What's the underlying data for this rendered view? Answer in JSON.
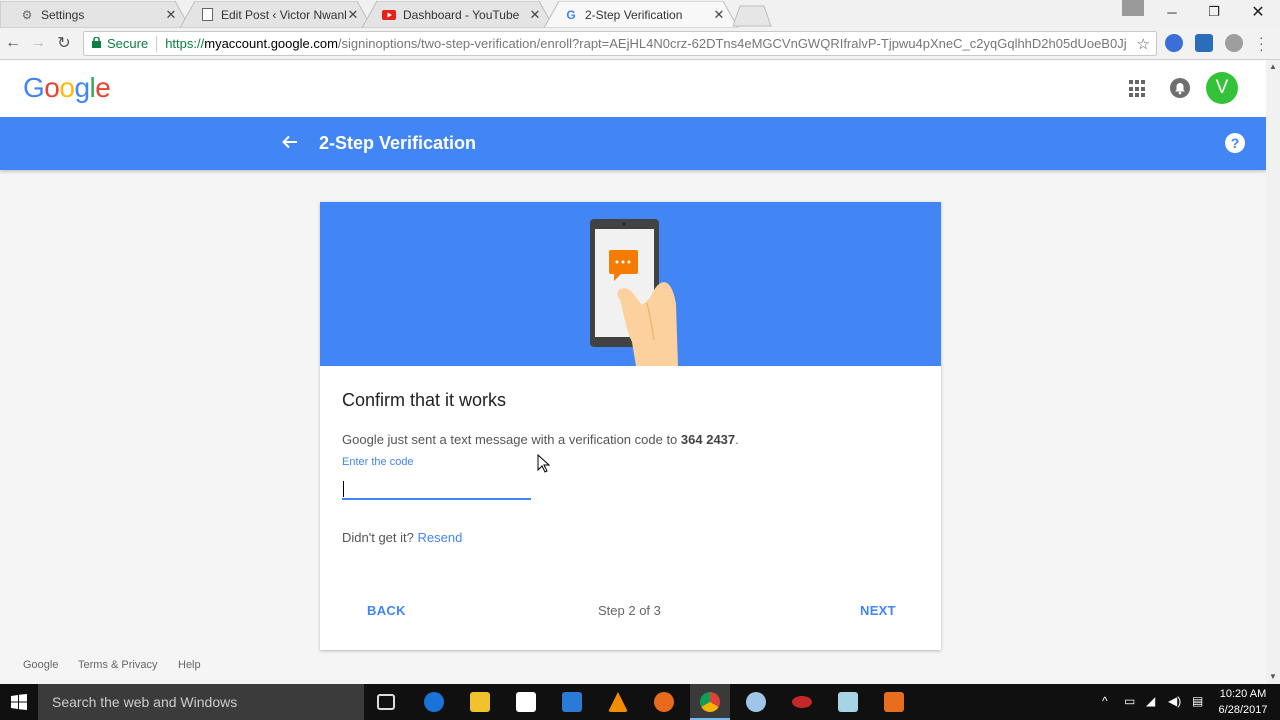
{
  "browser": {
    "tabs": [
      {
        "title": "Settings",
        "icon": "gear-icon"
      },
      {
        "title": "Edit Post ‹ Victor Nwanky",
        "icon": "document-icon"
      },
      {
        "title": "Dashboard - YouTube",
        "icon": "youtube-icon"
      },
      {
        "title": "2-Step Verification",
        "icon": "google-icon"
      }
    ],
    "secure_label": "Secure",
    "url_scheme": "https://",
    "url_host": "myaccount.google.com",
    "url_path": "/signinoptions/two-step-verification/enroll?rapt=AEjHL4N0crz-62DTns4eMGCVnGWQRIfralvP-Tjpwu4pXneC_c2yqGqlhhD2h05dUoeB0Jj"
  },
  "header": {
    "logo": "Google",
    "avatar_initial": "V"
  },
  "titlebar": {
    "title": "2-Step Verification",
    "help": "?"
  },
  "card": {
    "heading": "Confirm that it works",
    "message_prefix": "Google just sent a text message with a verification code to ",
    "phone": "364 2437",
    "message_suffix": ".",
    "field_label": "Enter the code",
    "field_value": "",
    "didnt_get": "Didn't get it?",
    "resend": "Resend",
    "back": "BACK",
    "step": "Step 2 of 3",
    "next": "NEXT"
  },
  "footer": {
    "links": [
      "Google",
      "Terms & Privacy",
      "Help"
    ]
  },
  "taskbar": {
    "search_placeholder": "Search the web and Windows",
    "time": "10:20 AM",
    "date": "6/28/2017"
  },
  "colors": {
    "google_blue": "#4285f4",
    "secure_green": "#0b8043",
    "avatar_green": "#34c338",
    "taskbar": "#101010"
  }
}
